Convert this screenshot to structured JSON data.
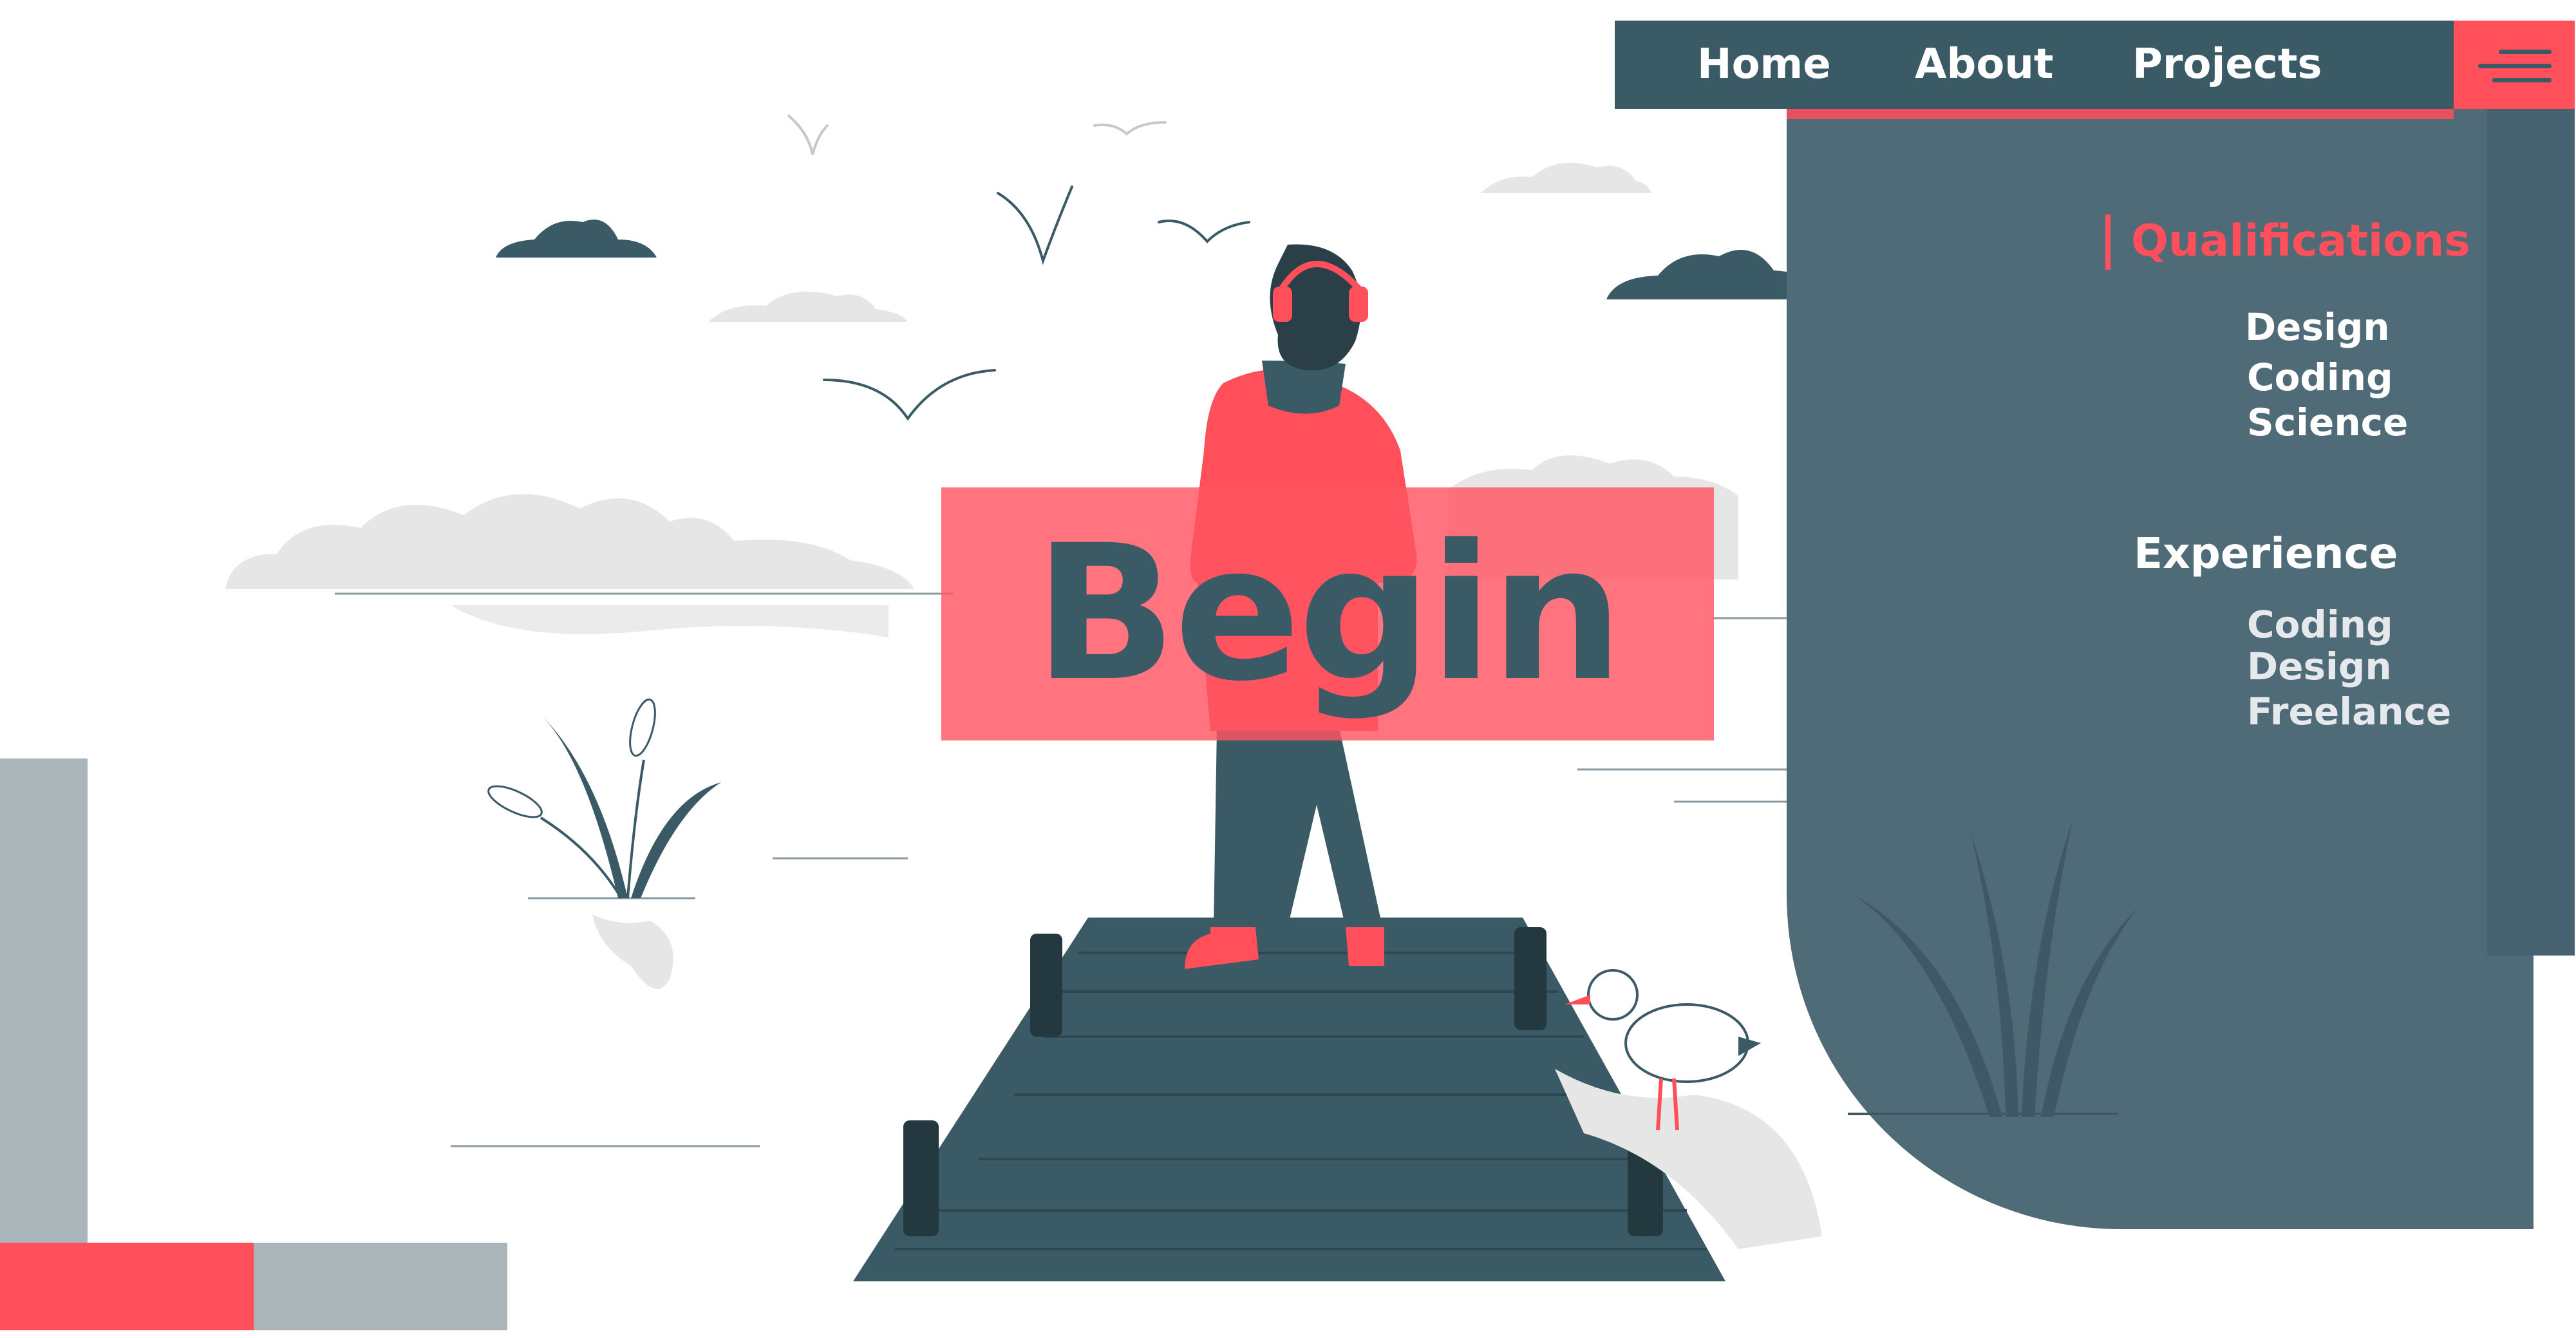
{
  "nav": {
    "links": [
      "Home",
      "About",
      "Projects"
    ],
    "menu_icon": "hamburger-menu-icon"
  },
  "hero": {
    "title": "Begin"
  },
  "panel": {
    "qualifications": {
      "title": "Qualifications",
      "items": [
        "Design",
        "Coding",
        "Science"
      ]
    },
    "experience": {
      "title": "Experience",
      "items": [
        "Coding",
        "Design",
        "Freelance"
      ]
    }
  },
  "illustration": {
    "subject": "person-with-headphones-on-pier",
    "icons": [
      "cloud-icon",
      "bird-icon",
      "seagull-icon",
      "reeds-icon",
      "pier-icon"
    ]
  },
  "colors": {
    "accent_red": "#ff4f5a",
    "dark_slate": "#3a5a66",
    "panel_slate": "#4f6b77",
    "light_grey": "#a9b5b9"
  }
}
